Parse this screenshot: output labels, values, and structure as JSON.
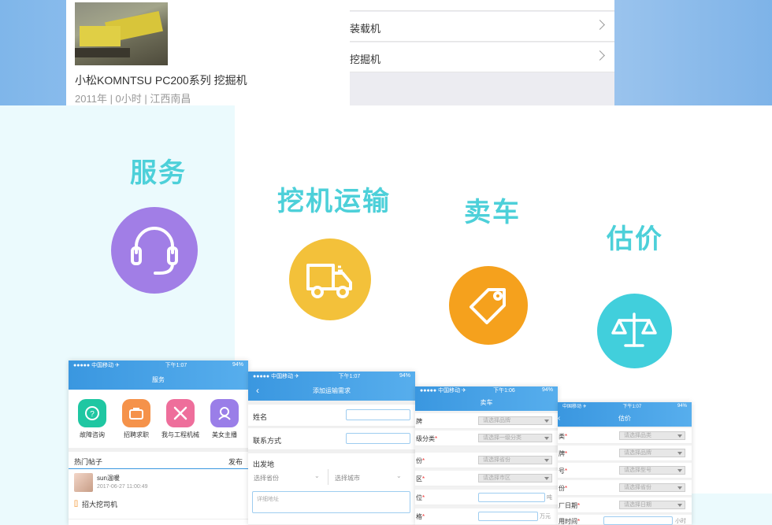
{
  "top_card": {
    "machine_name": "小松KOMNTSU PC200系列 挖掘机",
    "machine_meta": "2011年 | 0小时 | 江西南昌"
  },
  "category_list": [
    {
      "label": "装载机"
    },
    {
      "label": "挖掘机"
    }
  ],
  "features": [
    {
      "title": "服务",
      "icon": "headset-icon",
      "color": "#a17ee6"
    },
    {
      "title": "挖机运输",
      "icon": "truck-icon",
      "color": "#f3c13a"
    },
    {
      "title": "卖车",
      "icon": "price-tag-icon",
      "color": "#f5a11d"
    },
    {
      "title": "估价",
      "icon": "scale-icon",
      "color": "#41cfdc"
    }
  ],
  "phone_service": {
    "status_left": "●●●●● 中国移动 ✈",
    "status_time": "下午1:07",
    "status_right": "94%",
    "title": "服务",
    "apps": [
      {
        "label": "故障咨询",
        "icon": "repair-question-icon",
        "color": "#1fc7a2"
      },
      {
        "label": "招聘求职",
        "icon": "briefcase-icon",
        "color": "#f5924a"
      },
      {
        "label": "我与工程机械",
        "icon": "tools-icon",
        "color": "#ee6e9b"
      },
      {
        "label": "美女主播",
        "icon": "woman-icon",
        "color": "#9a7ee8"
      }
    ],
    "hot_posts": "热门帖子",
    "publish": "发布",
    "post_user": "sun温暖",
    "post_time": "2017-06-27 11:00:49",
    "post_text": "招大挖司机"
  },
  "phone_transport": {
    "status_left": "●●●●● 中国移动 ✈",
    "status_time": "下午1:07",
    "status_right": "94%",
    "title": "添加运输需求",
    "name_label": "姓名",
    "contact_label": "联系方式",
    "origin_label": "出发地",
    "province_placeholder": "选择省份",
    "city_placeholder": "选择城市",
    "address_placeholder": "详细地址"
  },
  "phone_sell": {
    "status_left": "●●●●● 中国移动 ✈",
    "status_time": "下午1:06",
    "status_right": "94%",
    "title": "卖车",
    "rows": [
      {
        "label": "牌",
        "value": "请选择品牌"
      },
      {
        "label": "级分类",
        "value": "请选择一级分类"
      },
      {
        "label": "份",
        "value": "请选择省份"
      },
      {
        "label": "区",
        "value": "请选择市区"
      },
      {
        "label": "位",
        "value": ""
      },
      {
        "label": "格",
        "value": ""
      }
    ],
    "unit1": "吨",
    "unit2": "万元"
  },
  "phone_estimate": {
    "status_left": "中国移动 ✈",
    "status_time": "下午1:07",
    "status_right": "94%",
    "title": "估价",
    "rows": [
      {
        "label": "类",
        "value": "请选择品类"
      },
      {
        "label": "牌",
        "value": "请选择品牌"
      },
      {
        "label": "号",
        "value": "请选择型号"
      },
      {
        "label": "份",
        "value": "请选择省份"
      },
      {
        "label": "厂日期",
        "value": "请选择日期"
      },
      {
        "label": "用时间",
        "value": ""
      }
    ],
    "unit": "小时"
  }
}
